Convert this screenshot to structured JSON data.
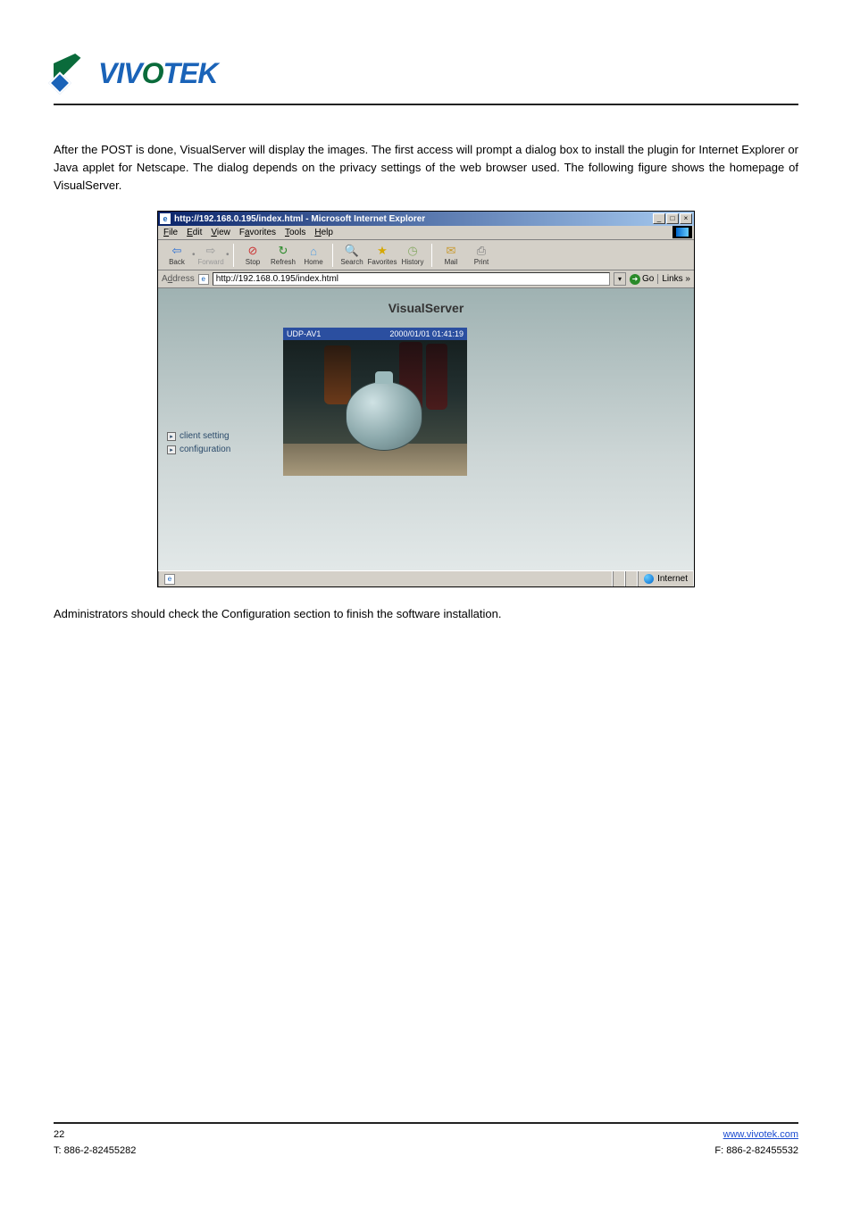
{
  "logo": {
    "text_a": "VIV",
    "text_o": "O",
    "text_b": "TEK"
  },
  "paragraphs": {
    "p1": "After the POST is done, VisualServer will display the images. The first access will prompt a dialog box to install the plugin for Internet Explorer or Java applet for Netscape. The dialog depends on the privacy settings of the web browser used. The following figure shows the homepage of VisualServer.",
    "p2": "Administrators should check the Configuration section to finish the software installation."
  },
  "ie": {
    "title": "http://192.168.0.195/index.html - Microsoft Internet Explorer",
    "minimize": "_",
    "maximize": "□",
    "close": "×",
    "menu": {
      "file": "File",
      "edit": "Edit",
      "view": "View",
      "favorites": "Favorites",
      "tools": "Tools",
      "help": "Help"
    },
    "toolbar": {
      "back": "Back",
      "forward": "Forward",
      "stop": "Stop",
      "refresh": "Refresh",
      "home": "Home",
      "search": "Search",
      "favorites": "Favorites",
      "history": "History",
      "mail": "Mail",
      "print": "Print"
    },
    "address_label": "Address",
    "address_value": "http://192.168.0.195/index.html",
    "go": "Go",
    "links": "Links »",
    "content": {
      "title": "VisualServer",
      "sidebar": {
        "client_setting": "client setting",
        "configuration": "configuration",
        "bullet": "▸"
      },
      "caption_left": "UDP-AV1",
      "caption_right": "2000/01/01 01:41:19"
    },
    "status": {
      "left": "",
      "zone": "Internet"
    }
  },
  "footer": {
    "page": "22",
    "company": "www.vivotek.com",
    "tel": "T: 886-2-82455282",
    "fax": "F: 886-2-82455532"
  }
}
